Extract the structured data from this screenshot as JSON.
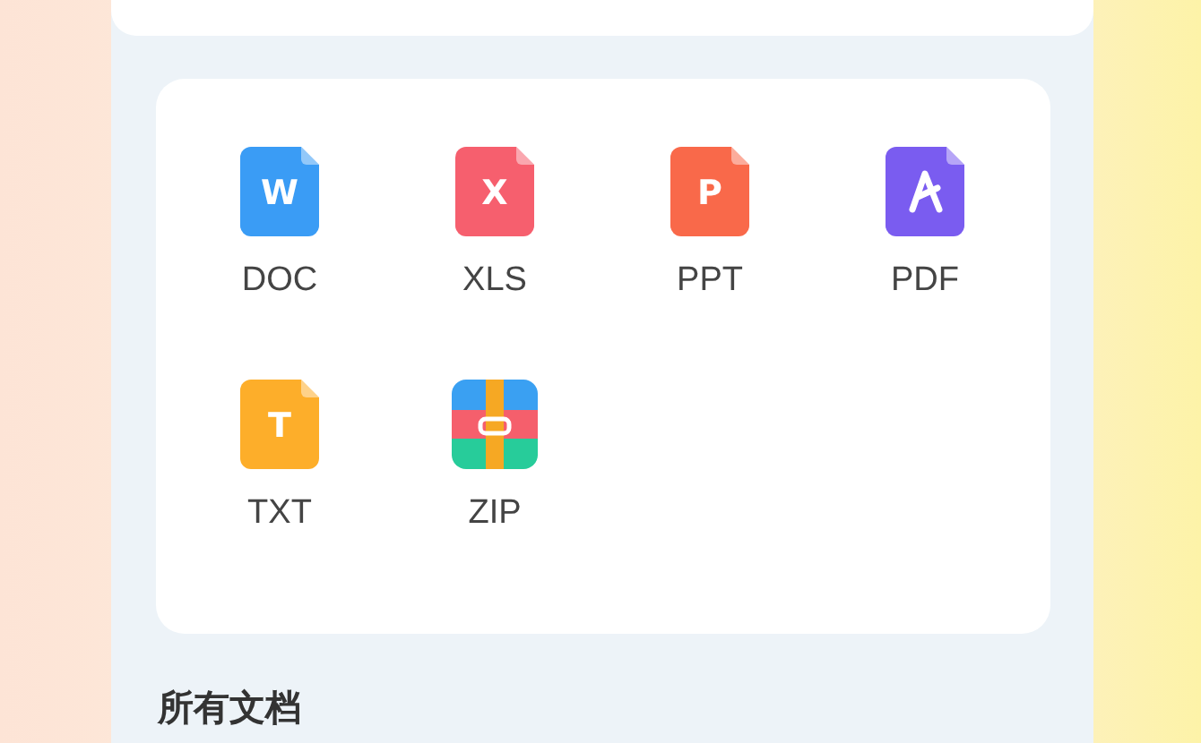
{
  "file_types": [
    {
      "kind": "file",
      "label": "DOC",
      "letter": "W",
      "color": "#3a9cf5"
    },
    {
      "kind": "file",
      "label": "XLS",
      "letter": "X",
      "color": "#f65f6e"
    },
    {
      "kind": "file",
      "label": "PPT",
      "letter": "P",
      "color": "#f9694a"
    },
    {
      "kind": "file",
      "label": "PDF",
      "color": "#7a5cf0"
    },
    {
      "kind": "file",
      "label": "TXT",
      "letter": "T",
      "color": "#fdae2a"
    },
    {
      "kind": "archive",
      "label": "ZIP"
    }
  ],
  "section_title": "所有文档"
}
